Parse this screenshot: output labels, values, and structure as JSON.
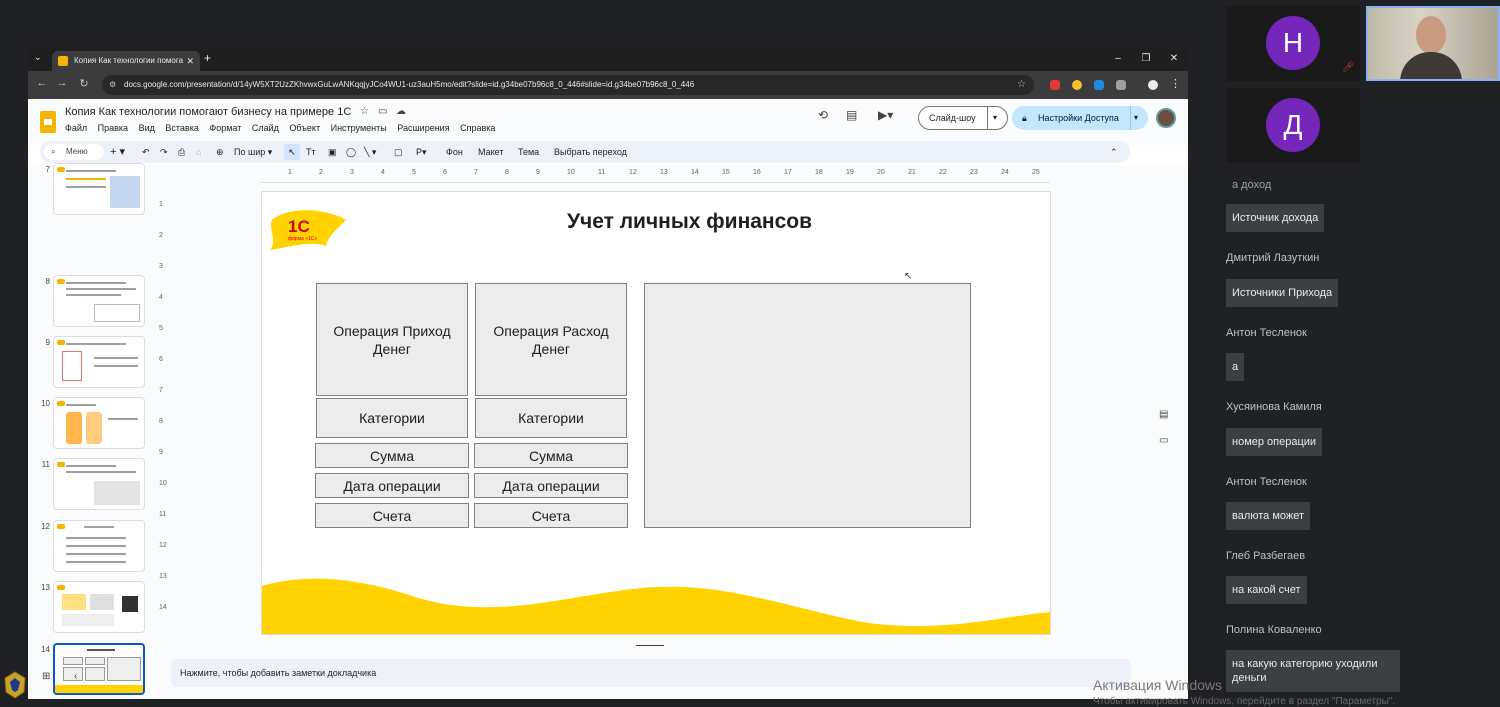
{
  "browser": {
    "tab_title": "Копия Как технологии помога",
    "url": "docs.google.com/presentation/d/14yW5XT2UzZKhvwxGuLwANKqqjyJCo4WU1-uz3auH5mo/edit?slide=id.g34be07b96c8_0_446#slide=id.g34be07b96c8_0_446"
  },
  "doc": {
    "title": "Копия Как технологии помогают бизнесу на примере 1С",
    "menu": [
      "Файл",
      "Правка",
      "Вид",
      "Вставка",
      "Формат",
      "Слайд",
      "Объект",
      "Инструменты",
      "Расширения",
      "Справка"
    ],
    "slideshow_label": "Слайд-шоу",
    "share_label": "Настройки Доступа"
  },
  "toolbar": {
    "menu_label": "Меню",
    "zoom_label": "По шир",
    "background_label": "Фон",
    "layout_label": "Макет",
    "theme_label": "Тема",
    "transition_label": "Выбрать переход"
  },
  "filmstrip": {
    "slides": [
      "7",
      "8",
      "9",
      "10",
      "11",
      "12",
      "13",
      "14"
    ],
    "active": "14"
  },
  "ruler": {
    "h_numbers": [
      "1",
      "2",
      "3",
      "4",
      "5",
      "6",
      "7",
      "8",
      "9",
      "10",
      "11",
      "12",
      "13",
      "14",
      "15",
      "16",
      "17",
      "18",
      "19",
      "20",
      "21",
      "22",
      "23",
      "24",
      "25"
    ],
    "v_numbers": [
      "1",
      "2",
      "3",
      "4",
      "5",
      "6",
      "7",
      "8",
      "9",
      "10",
      "11",
      "12",
      "13",
      "14"
    ]
  },
  "slide": {
    "title": "Учет личных финансов",
    "logo_text": "1С",
    "logo_sub": "фирма «1С»",
    "left_column": [
      "Операция Приход Денег",
      "Категории",
      "Сумма",
      "Дата операции",
      "Счета"
    ],
    "right_column": [
      "Операция Расход Денег",
      "Категории",
      "Сумма",
      "Дата операции",
      "Счета"
    ]
  },
  "notes_placeholder": "Нажмите, чтобы добавить заметки докладчика",
  "meet": {
    "participants": [
      {
        "initial": "Н",
        "color": "#7627bb"
      },
      {
        "initial": "Д",
        "color": "#7627bb"
      }
    ],
    "chat": [
      {
        "name": "",
        "message": "а доход"
      },
      {
        "name": "",
        "message": "Источник дохода"
      },
      {
        "name": "Дмитрий Лазуткин",
        "message": "Источники Прихода"
      },
      {
        "name": "Антон Тесленок",
        "message": "а"
      },
      {
        "name": "Хусяинова Камиля",
        "message": "номер операции"
      },
      {
        "name": "Антон Тесленок",
        "message": "валюта может"
      },
      {
        "name": "Глеб Разбегаев",
        "message": "на какой счет"
      },
      {
        "name": "Полина Коваленко",
        "message": "на какую категорию уходили деньги"
      }
    ]
  },
  "watermark": {
    "line1": "Активация Windows",
    "line2": "Чтобы активировать Windows, перейдите в раздел \"Параметры\"."
  },
  "colors": {
    "accent_yellow": "#ffd200",
    "share_button": "#c2e7ff",
    "avatar_purple": "#7627bb"
  }
}
